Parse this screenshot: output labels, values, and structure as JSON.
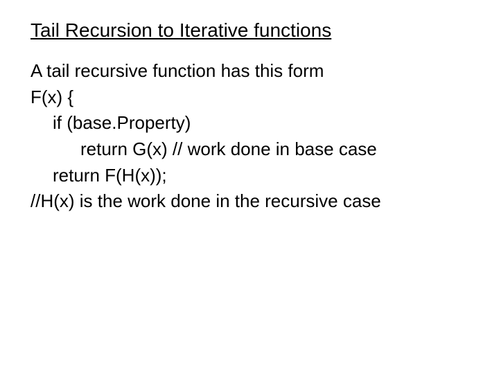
{
  "title": "Tail Recursion to Iterative functions",
  "body": {
    "line1": "A tail recursive function has this form",
    "line2": "F(x) {",
    "line3": "if (base.Property)",
    "line4": "return G(x) // work done in base case",
    "line5": "return F(H(x));",
    "line6": "//H(x) is the work done in the recursive case"
  }
}
